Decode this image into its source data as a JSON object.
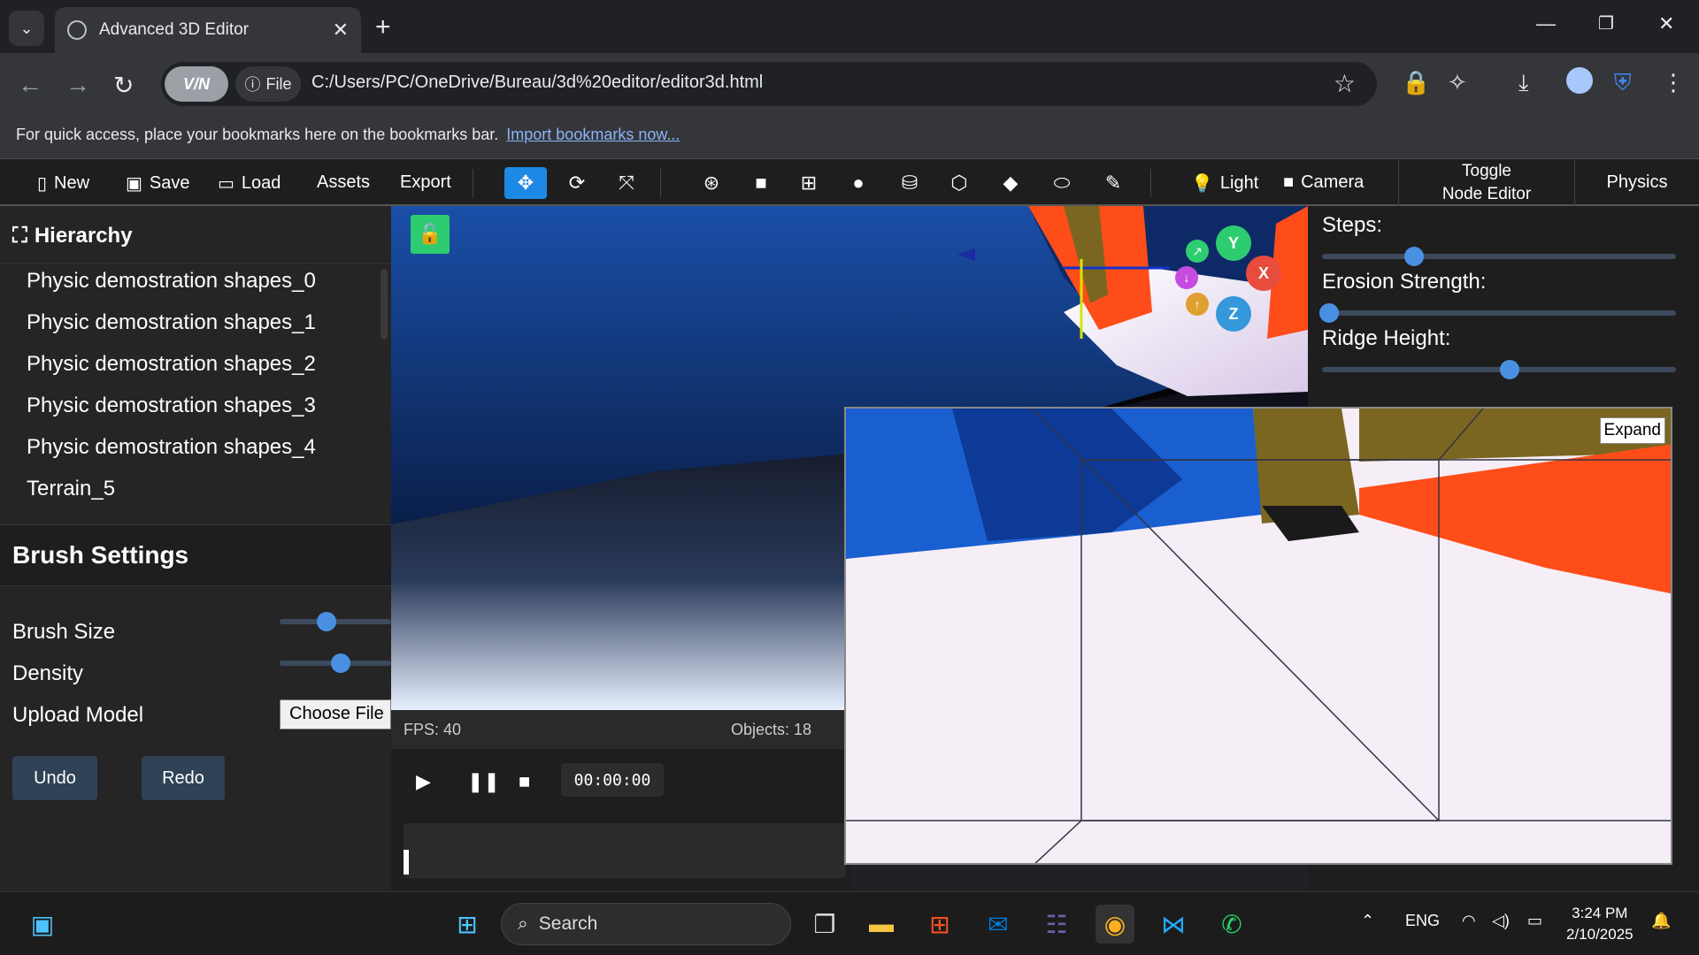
{
  "browser": {
    "tab_title": "Advanced 3D Editor",
    "tab_close": "✕",
    "new_tab": "+",
    "vpn_label": "V/N",
    "file_chip": "File",
    "url": "C:/Users/PC/OneDrive/Bureau/3d%20editor/editor3d.html",
    "bookmarks_text": "For quick access, place your bookmarks here on the bookmarks bar.",
    "bookmarks_link": "Import bookmarks now..."
  },
  "menu": {
    "new": "New",
    "save": "Save",
    "load": "Load",
    "assets": "Assets",
    "export": "Export",
    "light": "Light",
    "camera": "Camera",
    "toggle_line1": "Toggle",
    "toggle_line2": "Node Editor",
    "physics": "Physics"
  },
  "hierarchy": {
    "title": "Hierarchy",
    "items": [
      "Physic demostration shapes_0",
      "Physic demostration shapes_1",
      "Physic demostration shapes_2",
      "Physic demostration shapes_3",
      "Physic demostration shapes_4",
      "Terrain_5"
    ]
  },
  "brush": {
    "title": "Brush Settings",
    "size_label": "Brush Size",
    "density_label": "Density",
    "upload_label": "Upload Model",
    "choose_file": "Choose File",
    "undo": "Undo",
    "redo": "Redo",
    "size_value": 0.42,
    "density_value": 0.55
  },
  "viewport": {
    "fps": "FPS: 40",
    "objects": "Objects: 18",
    "gizmo_y": "Y",
    "gizmo_x": "X",
    "gizmo_z": "Z"
  },
  "timeline": {
    "time": "00:00:00"
  },
  "terrain": {
    "steps_label": "Steps:",
    "erosion_label": "Erosion Strength:",
    "ridge_label": "Ridge Height:",
    "steps_value": 0.26,
    "erosion_value": 0.02,
    "ridge_value": 0.53
  },
  "minimap": {
    "expand": "Expand"
  },
  "taskbar": {
    "search": "Search",
    "lang": "ENG",
    "time": "3:24 PM",
    "date": "2/10/2025"
  },
  "colors": {
    "accent": "#1e88e5",
    "lock_green": "#2ecc71",
    "gizmo_y": "#2ecc71",
    "gizmo_x": "#e74c3c",
    "gizmo_z": "#3498db",
    "terrain_red": "#ff4d1a"
  }
}
